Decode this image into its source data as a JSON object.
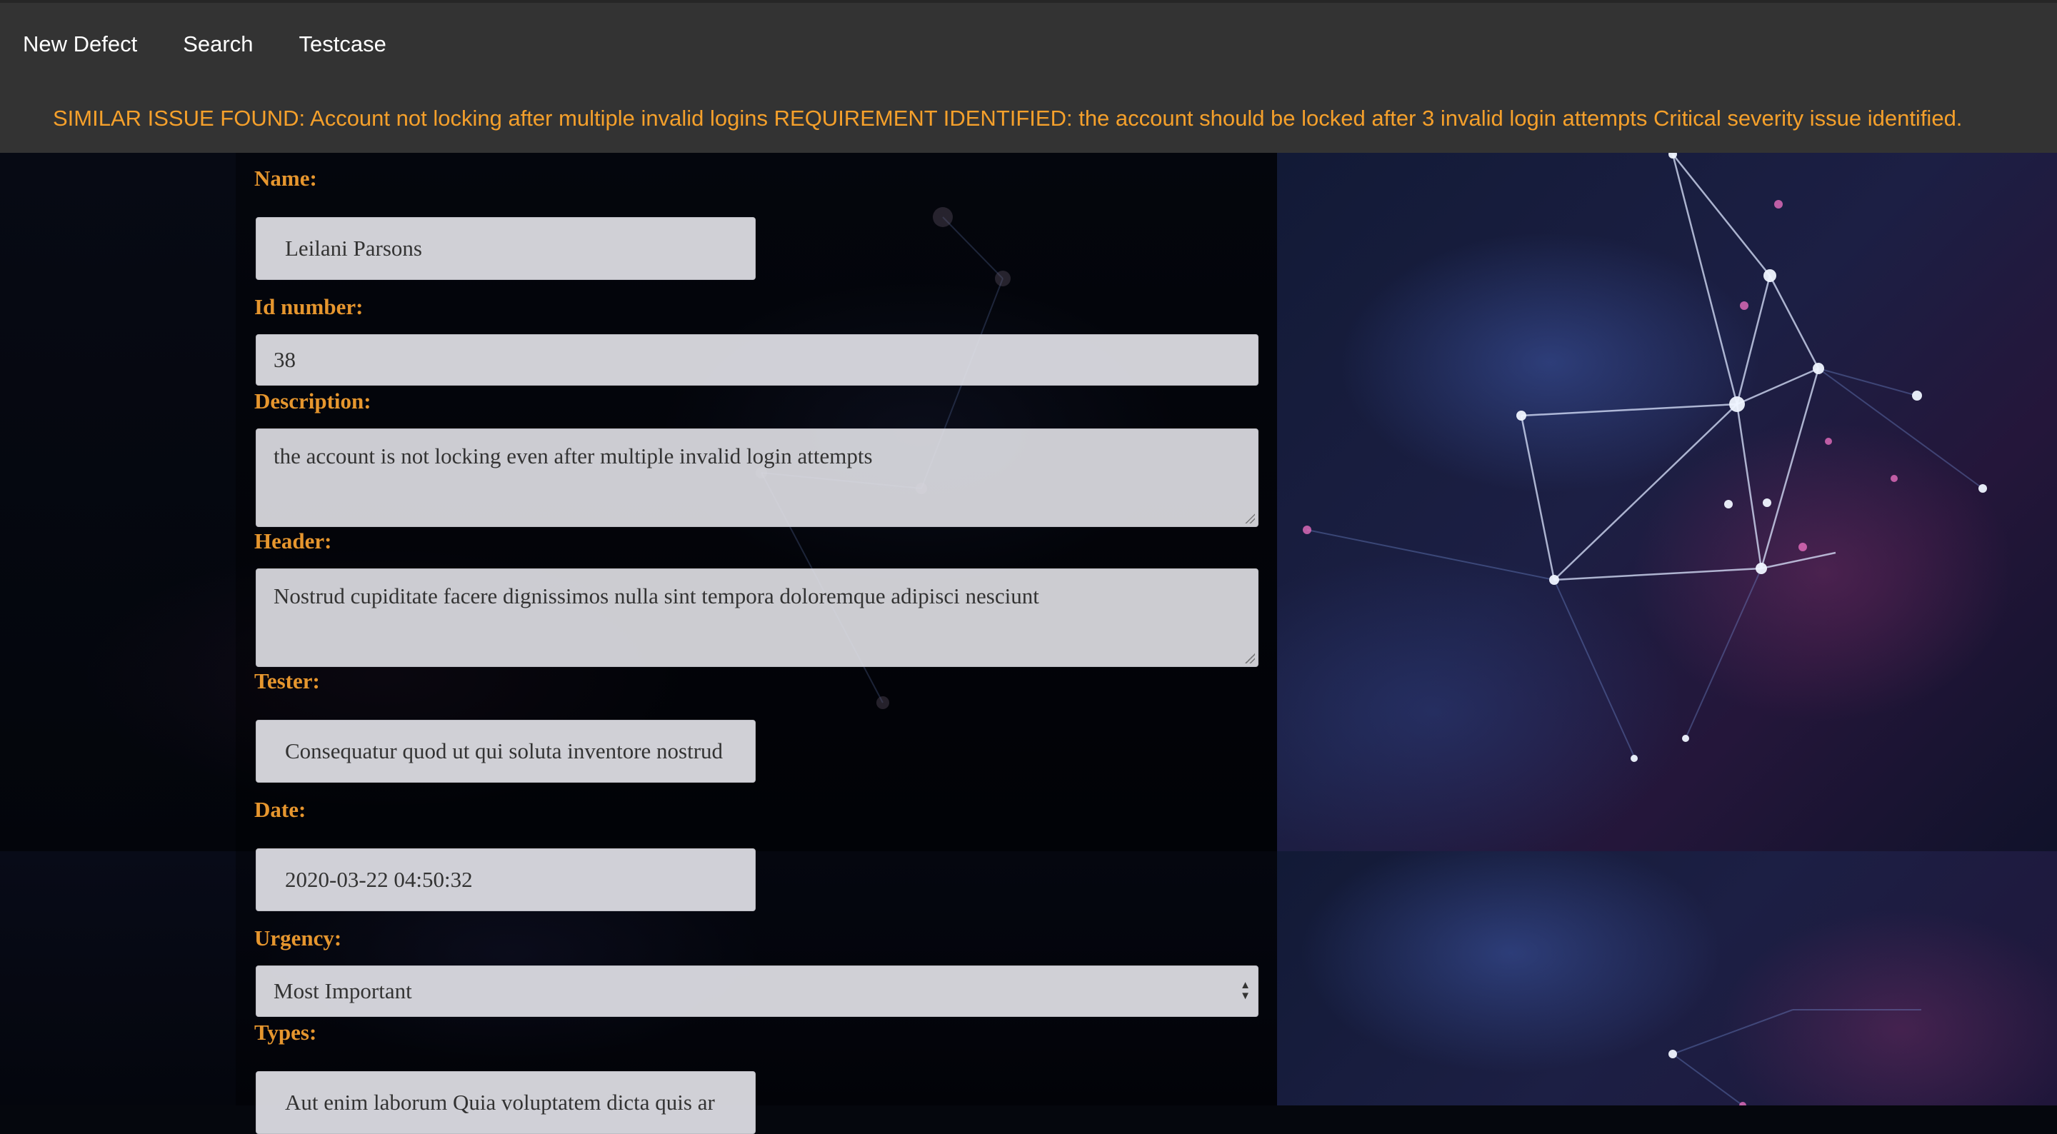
{
  "nav": {
    "items": [
      "New Defect",
      "Search",
      "Testcase"
    ]
  },
  "alert": {
    "text": "SIMILAR ISSUE FOUND: Account not locking after multiple invalid logins REQUIREMENT IDENTIFIED: the account should be locked after 3 invalid login attempts Critical severity issue identified."
  },
  "form": {
    "name_label": "Name:",
    "name_value": "Leilani Parsons",
    "id_label": "Id number:",
    "id_value": "38",
    "description_label": "Description:",
    "description_value": "the account is not locking even after multiple invalid login attempts",
    "header_label": "Header:",
    "header_value": "Nostrud cupiditate facere dignissimos nulla sint tempora doloremque adipisci nesciunt",
    "tester_label": "Tester:",
    "tester_value": "Consequatur quod ut qui soluta inventore nostrud",
    "date_label": "Date:",
    "date_value": "2020-03-22 04:50:32",
    "urgency_label": "Urgency:",
    "urgency_value": "Most Important",
    "types_label": "Types:",
    "types_value": "Aut enim laborum Quia voluptatem dicta quis ar"
  },
  "colors": {
    "accent": "#e6962e",
    "alert": "#f5a02b",
    "topbar": "#333333"
  }
}
